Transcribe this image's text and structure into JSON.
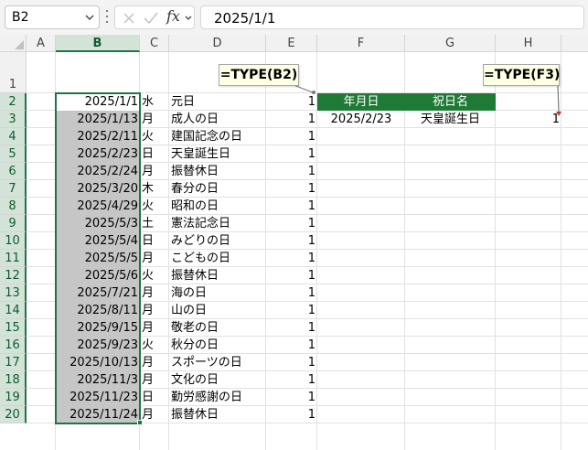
{
  "name_box": "B2",
  "formula_bar": {
    "fx": "fx",
    "value": "2025/1/1"
  },
  "columns": [
    "A",
    "B",
    "C",
    "D",
    "E",
    "F",
    "G",
    "H"
  ],
  "rows": [
    "1",
    "2",
    "3",
    "4",
    "5",
    "6",
    "7",
    "8",
    "9",
    "10",
    "11",
    "12",
    "13",
    "14",
    "15",
    "16",
    "17",
    "18",
    "19",
    "20"
  ],
  "holidays": [
    {
      "date": "2025/1/1",
      "dow": "水",
      "name": "元日",
      "type": "1"
    },
    {
      "date": "2025/1/13",
      "dow": "月",
      "name": "成人の日",
      "type": "1"
    },
    {
      "date": "2025/2/11",
      "dow": "火",
      "name": "建国記念の日",
      "type": "1"
    },
    {
      "date": "2025/2/23",
      "dow": "日",
      "name": "天皇誕生日",
      "type": "1"
    },
    {
      "date": "2025/2/24",
      "dow": "月",
      "name": "振替休日",
      "type": "1"
    },
    {
      "date": "2025/3/20",
      "dow": "木",
      "name": "春分の日",
      "type": "1"
    },
    {
      "date": "2025/4/29",
      "dow": "火",
      "name": "昭和の日",
      "type": "1"
    },
    {
      "date": "2025/5/3",
      "dow": "土",
      "name": "憲法記念日",
      "type": "1"
    },
    {
      "date": "2025/5/4",
      "dow": "日",
      "name": "みどりの日",
      "type": "1"
    },
    {
      "date": "2025/5/5",
      "dow": "月",
      "name": "こどもの日",
      "type": "1"
    },
    {
      "date": "2025/5/6",
      "dow": "火",
      "name": "振替休日",
      "type": "1"
    },
    {
      "date": "2025/7/21",
      "dow": "月",
      "name": "海の日",
      "type": "1"
    },
    {
      "date": "2025/8/11",
      "dow": "月",
      "name": "山の日",
      "type": "1"
    },
    {
      "date": "2025/9/15",
      "dow": "月",
      "name": "敬老の日",
      "type": "1"
    },
    {
      "date": "2025/9/23",
      "dow": "火",
      "name": "秋分の日",
      "type": "1"
    },
    {
      "date": "2025/10/13",
      "dow": "月",
      "name": "スポーツの日",
      "type": "1"
    },
    {
      "date": "2025/11/3",
      "dow": "月",
      "name": "文化の日",
      "type": "1"
    },
    {
      "date": "2025/11/23",
      "dow": "日",
      "name": "勤労感謝の日",
      "type": "1"
    },
    {
      "date": "2025/11/24",
      "dow": "月",
      "name": "振替休日",
      "type": "1"
    }
  ],
  "lookup": {
    "header_date": "年月日",
    "header_name": "祝日名",
    "date": "2025/2/23",
    "name": "天皇誕生日",
    "result": "1"
  },
  "callouts": {
    "left": "=TYPE(B2)",
    "right": "=TYPE(F3)"
  },
  "colors": {
    "accent": "#217346",
    "table_header": "#1e7a34",
    "selection_fill": "#c6c6c6"
  }
}
